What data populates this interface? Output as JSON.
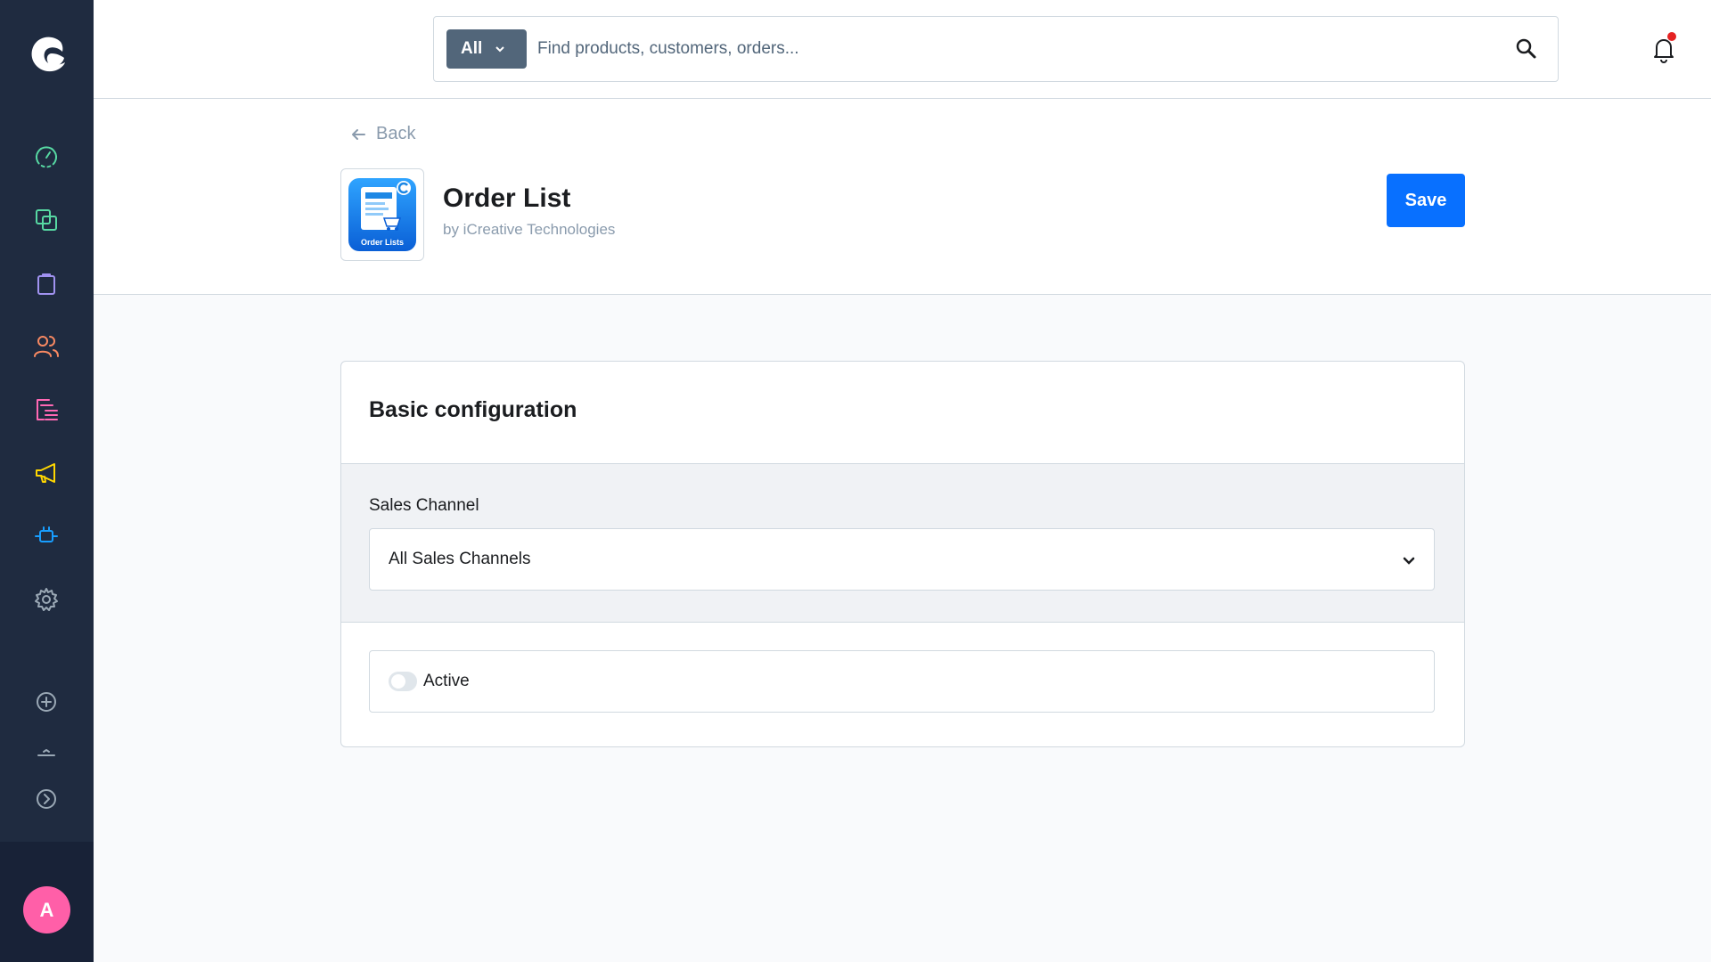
{
  "sidebar": {
    "items": [
      {
        "name": "dashboard",
        "color": "#57d9a3"
      },
      {
        "name": "catalogues",
        "color": "#57d9a3"
      },
      {
        "name": "orders",
        "color": "#a092f0"
      },
      {
        "name": "customers",
        "color": "#f88962"
      },
      {
        "name": "content",
        "color": "#ff68b4"
      },
      {
        "name": "marketing",
        "color": "#ffd700"
      },
      {
        "name": "extensions",
        "color": "#189eff"
      },
      {
        "name": "settings",
        "color": "#9aa8b5"
      }
    ],
    "avatar_initial": "A"
  },
  "search": {
    "scope": "All",
    "placeholder": "Find products, customers, orders..."
  },
  "header": {
    "back_label": "Back",
    "app_title": "Order List",
    "app_vendor": "by iCreative Technologies",
    "app_thumb_caption": "Order Lists",
    "save_label": "Save"
  },
  "card": {
    "title": "Basic configuration",
    "sales_channel_label": "Sales Channel",
    "sales_channel_value": "All Sales Channels",
    "active_label": "Active",
    "active_value": false
  }
}
